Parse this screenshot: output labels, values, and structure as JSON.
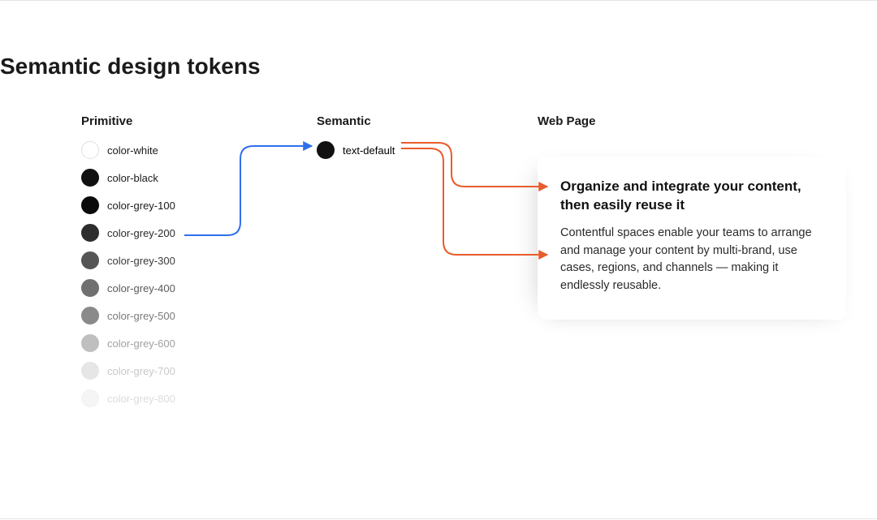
{
  "title": "Semantic design tokens",
  "columns": {
    "primitive": "Primitive",
    "semantic": "Semantic",
    "webpage": "Web Page"
  },
  "primitives": [
    {
      "label": "color-white",
      "swatch": "#ffffff",
      "border": "#e0e0e0",
      "textColor": "#1a1a1a"
    },
    {
      "label": "color-black",
      "swatch": "#111111",
      "border": "#111111",
      "textColor": "#1a1a1a"
    },
    {
      "label": "color-grey-100",
      "swatch": "#0b0b0b",
      "border": "#0b0b0b",
      "textColor": "#1a1a1a"
    },
    {
      "label": "color-grey-200",
      "swatch": "#2d2d2d",
      "border": "#2d2d2d",
      "textColor": "#2a2a2a"
    },
    {
      "label": "color-grey-300",
      "swatch": "#555555",
      "border": "#555555",
      "textColor": "#3a3a3a"
    },
    {
      "label": "color-grey-400",
      "swatch": "#707070",
      "border": "#707070",
      "textColor": "#5a5a5a"
    },
    {
      "label": "color-grey-500",
      "swatch": "#8a8a8a",
      "border": "#8a8a8a",
      "textColor": "#7a7a7a"
    },
    {
      "label": "color-grey-600",
      "swatch": "#bfbfbf",
      "border": "#bfbfbf",
      "textColor": "#a0a0a0"
    },
    {
      "label": "color-grey-700",
      "swatch": "#e6e6e6",
      "border": "#e6e6e6",
      "textColor": "#c8c8c8"
    },
    {
      "label": "color-grey-800",
      "swatch": "#f5f5f5",
      "border": "#f2f2f2",
      "textColor": "#dcdcdc"
    }
  ],
  "semantic_token": {
    "label": "text-default",
    "swatch": "#111111"
  },
  "card": {
    "title": "Organize and integrate your content, then easily reuse it",
    "body": "Contentful spaces enable your teams to arrange and manage your content by multi-brand, use cases, regions, and channels — making it endlessly reusable."
  },
  "colors": {
    "arrow_blue": "#2F6FED",
    "arrow_orange": "#E85C2B"
  }
}
